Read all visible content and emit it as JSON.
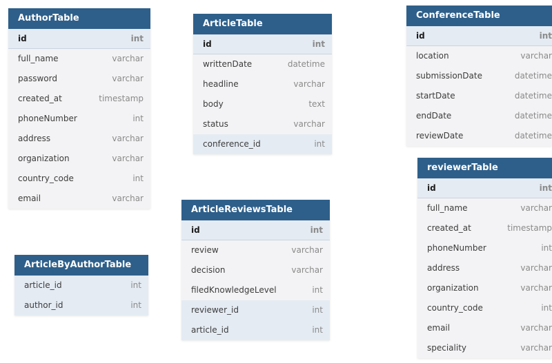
{
  "tables": {
    "author": {
      "title": "AuthorTable",
      "rows": [
        {
          "name": "id",
          "type": "int"
        },
        {
          "name": "full_name",
          "type": "varchar"
        },
        {
          "name": "password",
          "type": "varchar"
        },
        {
          "name": "created_at",
          "type": "timestamp"
        },
        {
          "name": "phoneNumber",
          "type": "int"
        },
        {
          "name": "address",
          "type": "varchar"
        },
        {
          "name": "organization",
          "type": "varchar"
        },
        {
          "name": "country_code",
          "type": "int"
        },
        {
          "name": "email",
          "type": "varchar"
        }
      ]
    },
    "article": {
      "title": "ArticleTable",
      "rows": [
        {
          "name": "id",
          "type": "int"
        },
        {
          "name": "writtenDate",
          "type": "datetime"
        },
        {
          "name": "headline",
          "type": "varchar"
        },
        {
          "name": "body",
          "type": "text"
        },
        {
          "name": "status",
          "type": "varchar"
        },
        {
          "name": "conference_id",
          "type": "int"
        }
      ]
    },
    "conference": {
      "title": "ConferenceTable",
      "rows": [
        {
          "name": "id",
          "type": "int"
        },
        {
          "name": "location",
          "type": "varchar"
        },
        {
          "name": "submissionDate",
          "type": "datetime"
        },
        {
          "name": "startDate",
          "type": "datetime"
        },
        {
          "name": "endDate",
          "type": "datetime"
        },
        {
          "name": "reviewDate",
          "type": "datetime"
        }
      ]
    },
    "reviewer": {
      "title": "reviewerTable",
      "rows": [
        {
          "name": "id",
          "type": "int"
        },
        {
          "name": "full_name",
          "type": "varchar"
        },
        {
          "name": "created_at",
          "type": "timestamp"
        },
        {
          "name": "phoneNumber",
          "type": "int"
        },
        {
          "name": "address",
          "type": "varchar"
        },
        {
          "name": "organization",
          "type": "varchar"
        },
        {
          "name": "country_code",
          "type": "int"
        },
        {
          "name": "email",
          "type": "varchar"
        },
        {
          "name": "speciality",
          "type": "varchar"
        }
      ]
    },
    "article_reviews": {
      "title": "ArticleReviewsTable",
      "rows": [
        {
          "name": "id",
          "type": "int"
        },
        {
          "name": "review",
          "type": "varchar"
        },
        {
          "name": "decision",
          "type": "varchar"
        },
        {
          "name": "filedKnowledgeLevel",
          "type": "int"
        },
        {
          "name": "reviewer_id",
          "type": "int"
        },
        {
          "name": "article_id",
          "type": "int"
        }
      ]
    },
    "article_by_author": {
      "title": "ArticleByAuthorTable",
      "rows": [
        {
          "name": "article_id",
          "type": "int"
        },
        {
          "name": "author_id",
          "type": "int"
        }
      ]
    }
  },
  "colors": {
    "header": "#2e5f8a",
    "key_row": "#e4ebf3",
    "body": "#f3f3f5"
  }
}
